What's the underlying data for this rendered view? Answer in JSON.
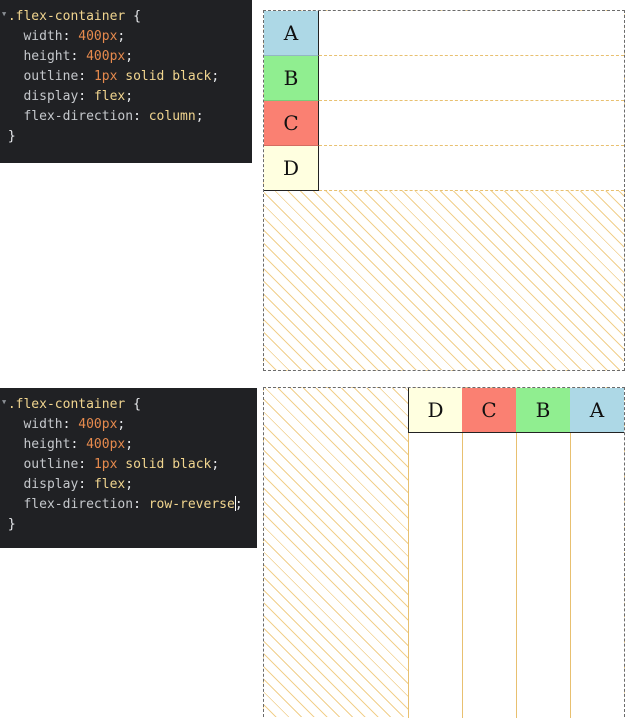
{
  "panels": [
    {
      "lines": [
        {
          "type": "open",
          "selector": ".flex-container",
          "brace": "{"
        },
        {
          "type": "decl",
          "prop": "width",
          "num": "400px",
          "rest": ""
        },
        {
          "type": "decl",
          "prop": "height",
          "num": "400px",
          "rest": ""
        },
        {
          "type": "decl",
          "prop": "outline",
          "num": "1px",
          "rest": " solid black"
        },
        {
          "type": "decl",
          "prop": "display",
          "num": "",
          "rest": "flex"
        },
        {
          "type": "decl",
          "prop": "flex-direction",
          "num": "",
          "rest": "column"
        },
        {
          "type": "close",
          "brace": "}"
        }
      ]
    },
    {
      "lines": [
        {
          "type": "open",
          "selector": ".flex-container",
          "brace": "{"
        },
        {
          "type": "decl",
          "prop": "width",
          "num": "400px",
          "rest": ""
        },
        {
          "type": "decl",
          "prop": "height",
          "num": "400px",
          "rest": ""
        },
        {
          "type": "decl",
          "prop": "outline",
          "num": "1px",
          "rest": " solid black"
        },
        {
          "type": "decl",
          "prop": "display",
          "num": "",
          "rest": "flex"
        },
        {
          "type": "decl",
          "prop": "flex-direction",
          "num": "",
          "rest": "row-reverse",
          "caret": true
        },
        {
          "type": "close",
          "brace": "}"
        }
      ]
    }
  ],
  "demo1": {
    "items": [
      {
        "label": "A",
        "color": "#add8e6"
      },
      {
        "label": "B",
        "color": "#90ee90"
      },
      {
        "label": "C",
        "color": "#fa8072"
      },
      {
        "label": "D",
        "color": "#ffffe0"
      }
    ]
  },
  "demo2": {
    "items": [
      {
        "label": "D",
        "color": "#ffffe0"
      },
      {
        "label": "C",
        "color": "#fa8072"
      },
      {
        "label": "B",
        "color": "#90ee90"
      },
      {
        "label": "A",
        "color": "#add8e6"
      }
    ]
  }
}
